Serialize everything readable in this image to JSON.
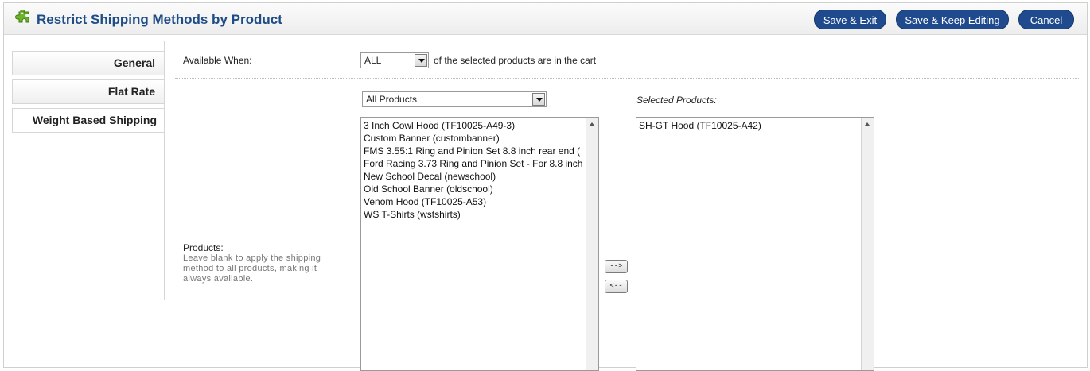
{
  "header": {
    "title": "Restrict Shipping Methods by Product",
    "buttons": {
      "save_exit": "Save & Exit",
      "save_keep": "Save & Keep Editing",
      "cancel": "Cancel"
    }
  },
  "tabs": [
    {
      "label": "General",
      "active": false
    },
    {
      "label": "Flat Rate",
      "active": false
    },
    {
      "label": "Weight Based Shipping",
      "active": true
    }
  ],
  "available_when": {
    "label": "Available When:",
    "selected": "ALL",
    "suffix": "of the selected products are in the cart"
  },
  "products": {
    "label": "Products:",
    "help": "Leave blank to apply the shipping method to all products, making it always available.",
    "filter_selected": "All Products",
    "available": [
      "3 Inch Cowl Hood (TF10025-A49-3)",
      "Custom Banner (custombanner)",
      "FMS 3.55:1 Ring and Pinion Set 8.8 inch rear end (",
      "Ford Racing 3.73 Ring and Pinion Set - For 8.8 inch",
      "New School Decal (newschool)",
      "Old School Banner (oldschool)",
      "Venom Hood (TF10025-A53)",
      "WS T-Shirts (wstshirts)"
    ],
    "selected_label": "Selected Products:",
    "selected": [
      "SH-GT Hood (TF10025-A42)"
    ],
    "add_label": "-->",
    "remove_label": "<--"
  },
  "colors": {
    "title": "#1e4c86",
    "button_bg": "#1f4b8e",
    "icon": "#5aa31f"
  },
  "icons": {
    "header": "puzzle-piece-icon"
  }
}
